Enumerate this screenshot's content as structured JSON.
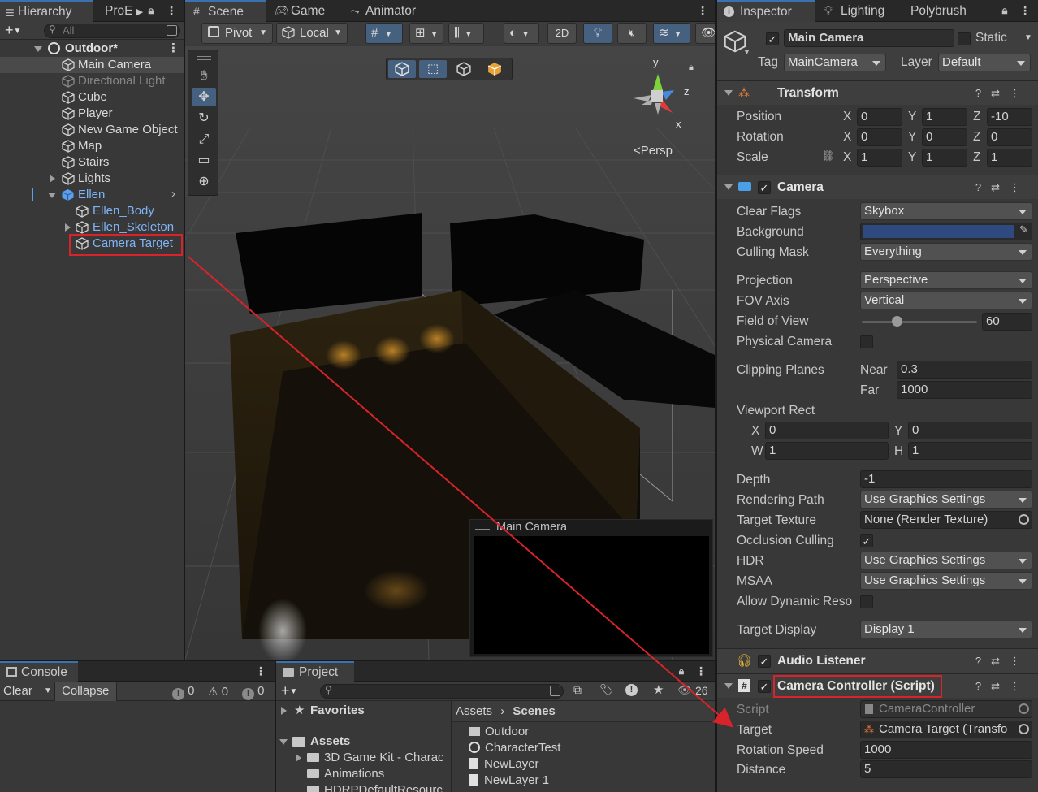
{
  "hierarchy": {
    "tab_label": "Hierarchy",
    "tab2_label": "ProE",
    "search_placeholder": "All",
    "scene_name": "Outdoor*",
    "items": [
      "Main Camera",
      "Directional Light",
      "Cube",
      "Player",
      "New Game Object",
      "Map",
      "Stairs",
      "Lights",
      "Ellen",
      "Ellen_Body",
      "Ellen_Skeleton",
      "Camera Target"
    ]
  },
  "scene": {
    "tabs": [
      "Scene",
      "Game",
      "Animator"
    ],
    "pivot_label": "Pivot",
    "local_label": "Local",
    "mode_2d": "2D",
    "persp_label": "Persp",
    "gizmo_y": "y",
    "gizmo_z": "z",
    "gizmo_x": "x",
    "camera_preview_title": "Main Camera"
  },
  "inspector": {
    "tabs": [
      "Inspector",
      "Lighting",
      "Polybrush"
    ],
    "object_name": "Main Camera",
    "static_label": "Static",
    "tag_label": "Tag",
    "tag_value": "MainCamera",
    "layer_label": "Layer",
    "layer_value": "Default",
    "transform": {
      "title": "Transform",
      "position_label": "Position",
      "rotation_label": "Rotation",
      "scale_label": "Scale",
      "position": [
        "0",
        "1",
        "-10"
      ],
      "rotation": [
        "0",
        "0",
        "0"
      ],
      "scale": [
        "1",
        "1",
        "1"
      ],
      "axes": [
        "X",
        "Y",
        "Z"
      ]
    },
    "camera": {
      "title": "Camera",
      "clear_flags_label": "Clear Flags",
      "clear_flags": "Skybox",
      "background_label": "Background",
      "background_color": "#2e4a7e",
      "culling_mask_label": "Culling Mask",
      "culling_mask": "Everything",
      "projection_label": "Projection",
      "projection": "Perspective",
      "fov_axis_label": "FOV Axis",
      "fov_axis": "Vertical",
      "fov_label": "Field of View",
      "fov": "60",
      "fov_fraction": 0.3,
      "physical_label": "Physical Camera",
      "clipping_label": "Clipping Planes",
      "near_label": "Near",
      "near": "0.3",
      "far_label": "Far",
      "far": "1000",
      "viewport_label": "Viewport Rect",
      "vx_label": "X",
      "vx": "0",
      "vy_label": "Y",
      "vy": "0",
      "vw_label": "W",
      "vw": "1",
      "vh_label": "H",
      "vh": "1",
      "depth_label": "Depth",
      "depth": "-1",
      "rendering_path_label": "Rendering Path",
      "rendering_path": "Use Graphics Settings",
      "target_texture_label": "Target Texture",
      "target_texture": "None (Render Texture)",
      "occlusion_label": "Occlusion Culling",
      "hdr_label": "HDR",
      "hdr": "Use Graphics Settings",
      "msaa_label": "MSAA",
      "msaa": "Use Graphics Settings",
      "dyn_res_label": "Allow Dynamic Reso",
      "target_display_label": "Target Display",
      "target_display": "Display 1"
    },
    "audio_listener": {
      "title": "Audio Listener"
    },
    "controller": {
      "title": "Camera Controller (Script)",
      "script_label": "Script",
      "script": "CameraController",
      "target_label": "Target",
      "target": "Camera Target (Transfo",
      "rotation_speed_label": "Rotation Speed",
      "rotation_speed": "1000",
      "distance_label": "Distance",
      "distance": "5"
    }
  },
  "console": {
    "tab_label": "Console",
    "clear_label": "Clear",
    "collapse_label": "Collapse",
    "info_count": "0",
    "warn_count": "0",
    "error_count": "0"
  },
  "project": {
    "tab_label": "Project",
    "favorites_label": "Favorites",
    "assets_label": "Assets",
    "asset_folders": [
      "3D Game Kit - Charac",
      "Animations",
      "HDRPDefaultResourc"
    ],
    "breadcrumb": [
      "Assets",
      "Scenes"
    ],
    "files": [
      "Outdoor",
      "CharacterTest",
      "NewLayer",
      "NewLayer 1"
    ],
    "hidden_count": "26"
  },
  "colors": {
    "accent": "#3a72b0",
    "annotation_red": "#d8232a",
    "selected_text": "#7fb4f5"
  }
}
